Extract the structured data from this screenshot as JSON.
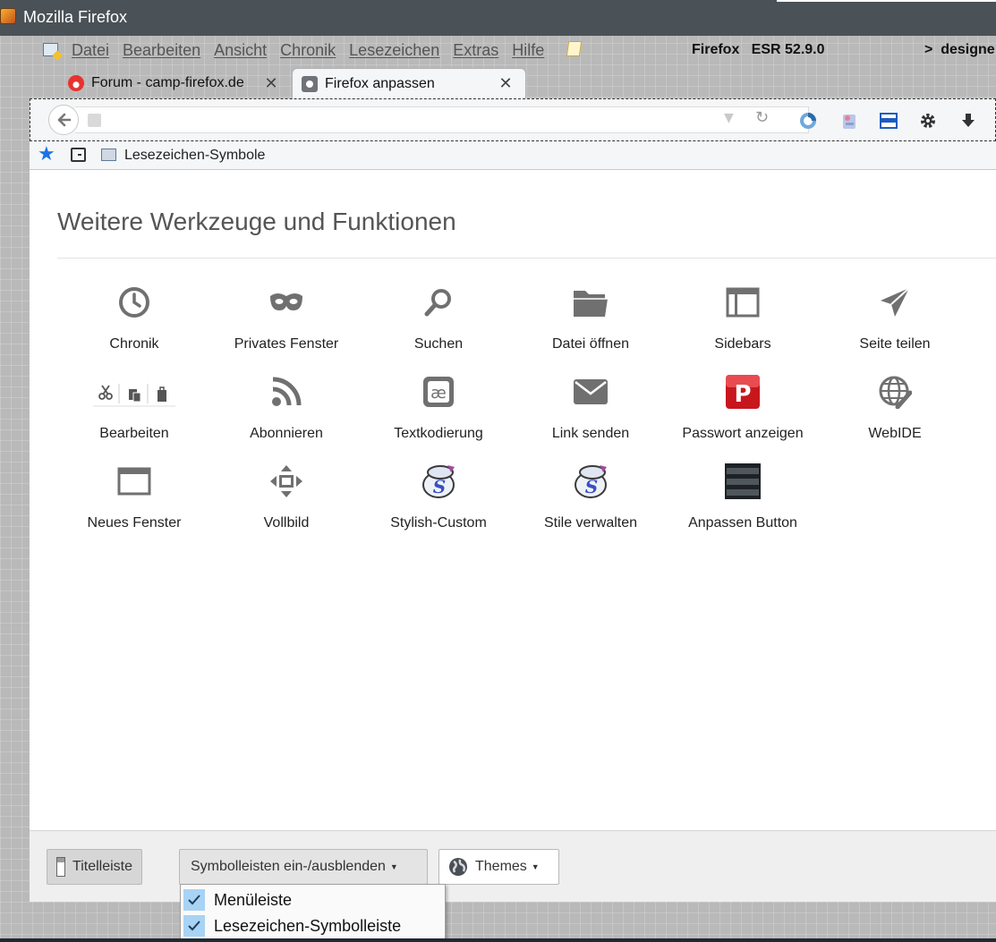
{
  "window": {
    "title": "Mozilla Firefox"
  },
  "menubar": {
    "items": [
      "Datei",
      "Bearbeiten",
      "Ansicht",
      "Chronik",
      "Lesezeichen",
      "Extras",
      "Hilfe"
    ],
    "version_text": "Firefox   ESR 52.9.0",
    "designer_text": ">  designe"
  },
  "tabs": [
    {
      "label": "Forum - camp-firefox.de",
      "icon": "fire-icon",
      "active": false
    },
    {
      "label": "Firefox anpassen",
      "icon": "gear-icon",
      "active": true
    }
  ],
  "navbar": {
    "icons": [
      "firefox-sync-icon",
      "addon-icon",
      "sidebar-toggle-icon",
      "settings-gear-icon",
      "download-arrow-icon"
    ]
  },
  "bookmarks": {
    "folder_label": "Lesezeichen-Symbole"
  },
  "customize": {
    "section_title": "Weitere Werkzeuge und Funktionen",
    "tools": [
      {
        "label": "Chronik",
        "icon": "clock-icon"
      },
      {
        "label": "Privates Fenster",
        "icon": "mask-icon"
      },
      {
        "label": "Suchen",
        "icon": "magnifier-icon"
      },
      {
        "label": "Datei öffnen",
        "icon": "folder-icon"
      },
      {
        "label": "Sidebars",
        "icon": "sidebar-icon"
      },
      {
        "label": "Seite teilen",
        "icon": "paper-plane-icon"
      },
      {
        "label": "Bearbeiten",
        "icon": "edit-tools-icon"
      },
      {
        "label": "Abonnieren",
        "icon": "rss-icon"
      },
      {
        "label": "Textkodierung",
        "icon": "text-encoding-icon"
      },
      {
        "label": "Link senden",
        "icon": "envelope-icon"
      },
      {
        "label": "Passwort anzeigen",
        "icon": "password-p-icon"
      },
      {
        "label": "WebIDE",
        "icon": "globe-wrench-icon"
      },
      {
        "label": "Neues Fenster",
        "icon": "new-window-icon"
      },
      {
        "label": "Vollbild",
        "icon": "fullscreen-arrows-icon"
      },
      {
        "label": "Stylish-Custom",
        "icon": "stylish-icon"
      },
      {
        "label": "Stile verwalten",
        "icon": "stylish-icon"
      },
      {
        "label": "Anpassen Button",
        "icon": "customize-bars-icon"
      }
    ]
  },
  "footer": {
    "titlebar_label": "Titelleiste",
    "toolbars_label": "Symbolleisten ein-/ausblenden",
    "themes_label": "Themes"
  },
  "toolbars_menu": {
    "items": [
      {
        "label": "Menüleiste",
        "checked": true
      },
      {
        "label": "Lesezeichen-Symbolleiste",
        "checked": true
      }
    ]
  },
  "colors": {
    "accent_blue": "#1a73e8",
    "check_bg": "#a8d3f5",
    "title_bar": "#4b5257"
  }
}
